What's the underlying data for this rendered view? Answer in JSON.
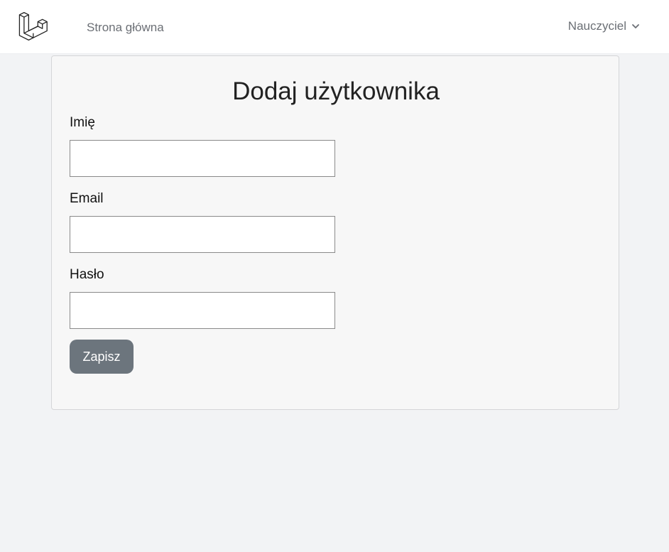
{
  "header": {
    "logo_icon": "laravel-logo-icon",
    "nav_home_label": "Strona główna",
    "user_menu_label": "Nauczyciel",
    "user_menu_icon": "chevron-down-icon"
  },
  "form": {
    "title": "Dodaj użytkownika",
    "fields": [
      {
        "label": "Imię",
        "value": "",
        "placeholder": ""
      },
      {
        "label": "Email",
        "value": "",
        "placeholder": ""
      },
      {
        "label": "Hasło",
        "value": "",
        "placeholder": ""
      }
    ],
    "submit_label": "Zapisz",
    "submit_color": "#6c757d"
  }
}
